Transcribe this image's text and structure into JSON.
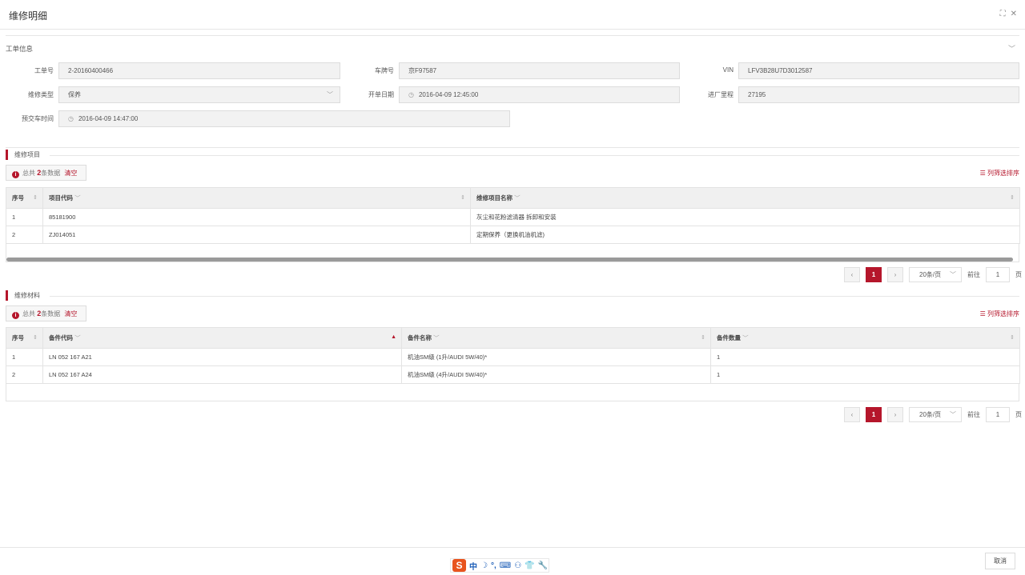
{
  "window": {
    "title": "维修明细",
    "maximize_glyph": "⛶",
    "close_glyph": "✕"
  },
  "basic": {
    "title": "工单信息",
    "fields": {
      "order_no": {
        "label": "工单号",
        "value": "2-20160400466"
      },
      "plate_no": {
        "label": "车牌号",
        "value": "京F97587"
      },
      "vin": {
        "label": "VIN",
        "value": "LFV3B28U7D3012587"
      },
      "repair_type": {
        "label": "维修类型",
        "value": "保养"
      },
      "open_date": {
        "label": "开单日期",
        "value": "2016-04-09 12:45:00"
      },
      "mileage": {
        "label": "进厂里程",
        "value": "27195"
      },
      "delivery_time": {
        "label": "预交车时间",
        "value": "2016-04-09 14:47:00"
      }
    }
  },
  "items": {
    "title": "维修项目",
    "total_prefix": "总共",
    "total_count": "2",
    "total_suffix": "条数据",
    "clear_label": "清空",
    "filter_label": "列筛选排序",
    "columns": [
      "序号",
      "项目代码",
      "维修项目名称"
    ],
    "rows": [
      {
        "no": "1",
        "code": "85181900",
        "name": "灰尘和花粉滤清器 拆卸和安装"
      },
      {
        "no": "2",
        "code": "ZJ014051",
        "name": "定期保养（更换机油机滤)"
      }
    ]
  },
  "materials": {
    "title": "维修材料",
    "total_prefix": "总共",
    "total_count": "2",
    "total_suffix": "条数据",
    "clear_label": "清空",
    "filter_label": "列筛选排序",
    "columns": [
      "序号",
      "备件代码",
      "备件名称",
      "备件数量"
    ],
    "rows": [
      {
        "no": "1",
        "code": "LN 052 167 A21",
        "name": "机油SM级 (1升/AUDI 5W/40)*",
        "qty": "1"
      },
      {
        "no": "2",
        "code": "LN 052 167 A24",
        "name": "机油SM级 (4升/AUDI 5W/40)*",
        "qty": "1"
      }
    ]
  },
  "pagination": {
    "prev": "‹",
    "next": "›",
    "current": "1",
    "page_size": "20条/页",
    "goto_label": "前往",
    "goto_value": "1",
    "page_unit": "页"
  },
  "footer": {
    "cancel_label": "取消"
  },
  "ime": {
    "logo": "S",
    "mode": "中",
    "items": [
      "☽",
      "°,",
      "⌨",
      "⚇",
      "👕",
      "🔧"
    ]
  }
}
